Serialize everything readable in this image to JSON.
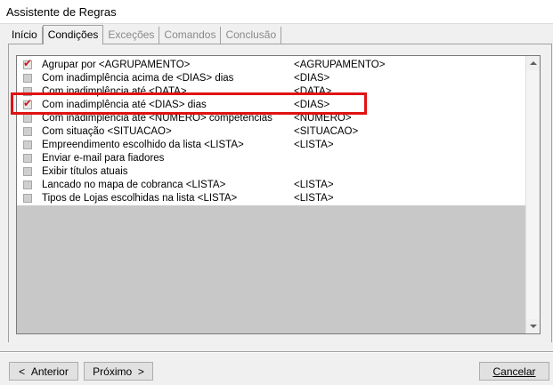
{
  "window": {
    "title": "Assistente de Regras"
  },
  "tabs": [
    {
      "label": "Início",
      "state": "normal"
    },
    {
      "label": "Condições",
      "state": "active"
    },
    {
      "label": "Exceções",
      "state": "disabled"
    },
    {
      "label": "Comandos",
      "state": "disabled"
    },
    {
      "label": "Conclusão",
      "state": "disabled"
    }
  ],
  "conditions": [
    {
      "name": "Agrupar por <AGRUPAMENTO>",
      "param": "<AGRUPAMENTO>",
      "checked": true
    },
    {
      "name": "Com inadimplência acima de <DIAS> dias",
      "param": "<DIAS>",
      "checked": false
    },
    {
      "name": "Com inadimplência até <DATA>",
      "param": "<DATA>",
      "checked": false
    },
    {
      "name": "Com inadimplência até <DIAS>  dias",
      "param": "<DIAS>",
      "checked": true
    },
    {
      "name": "Com inadimplência até <NUMERO> competências",
      "param": "<NUMERO>",
      "checked": false
    },
    {
      "name": "Com situação <SITUACAO>",
      "param": "<SITUACAO>",
      "checked": false
    },
    {
      "name": "Empreendimento escolhido da lista <LISTA>",
      "param": "<LISTA>",
      "checked": false
    },
    {
      "name": "Enviar e-mail para fiadores",
      "param": "",
      "checked": false
    },
    {
      "name": "Exibir títulos atuais",
      "param": "",
      "checked": false
    },
    {
      "name": "Lancado no mapa de cobranca <LISTA>",
      "param": "<LISTA>",
      "checked": false
    },
    {
      "name": "Tipos de Lojas escolhidas na lista <LISTA>",
      "param": "<LISTA>",
      "checked": false
    }
  ],
  "buttons": {
    "back": {
      "arrow": "<",
      "label": "Anterior"
    },
    "next": {
      "label": "Próximo",
      "arrow": ">"
    },
    "cancel": {
      "label": "Cancelar"
    }
  },
  "icons": {
    "scroll_up": "triangle-up",
    "scroll_down": "triangle-down",
    "checkbox_checked": "red-checkmark"
  },
  "colors": {
    "highlight": "#e01212",
    "checkmark": "#d01414",
    "list_empty_area": "#c8c8c8"
  }
}
